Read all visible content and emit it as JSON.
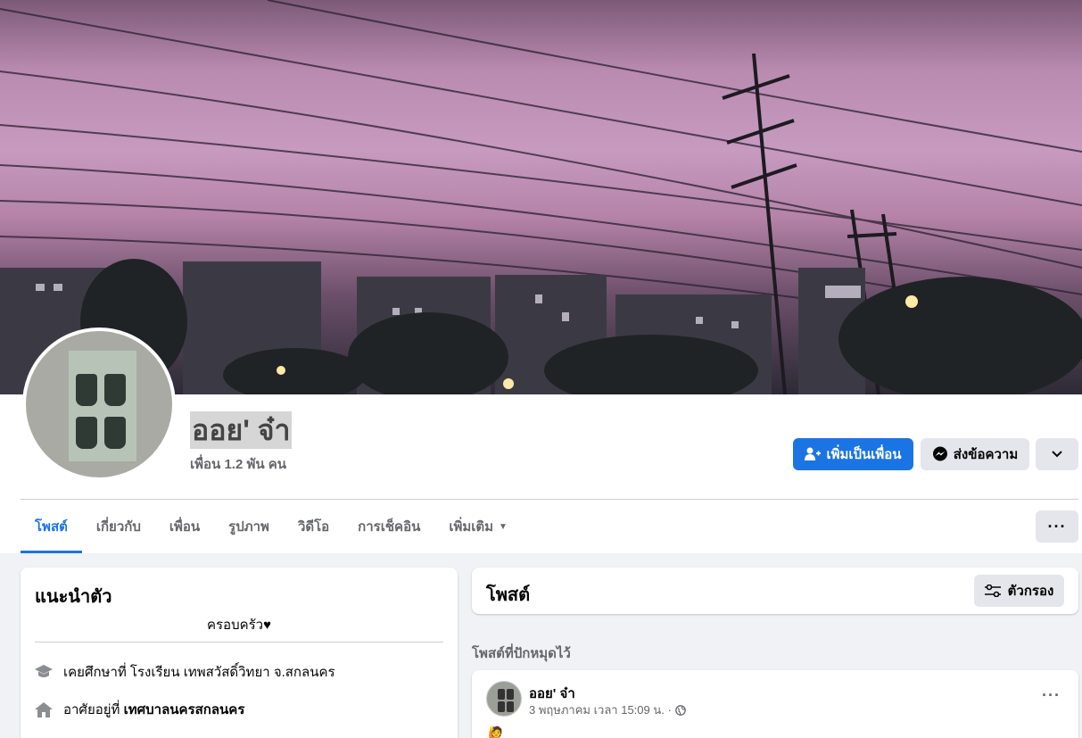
{
  "profile": {
    "name": "ออย' จ๋า",
    "friends": "เพื่อน 1.2 พัน คน"
  },
  "actions": {
    "add_friend": "เพิ่มเป็นเพื่อน",
    "message": "ส่งข้อความ"
  },
  "tabs": [
    {
      "label": "โพสต์",
      "active": true
    },
    {
      "label": "เกี่ยวกับ"
    },
    {
      "label": "เพื่อน"
    },
    {
      "label": "รูปภาพ"
    },
    {
      "label": "วิดีโอ"
    },
    {
      "label": "การเช็คอิน"
    },
    {
      "label": "เพิ่มเติม"
    }
  ],
  "intro": {
    "title": "แนะนำตัว",
    "bio": "ครอบครัว♥",
    "education_prefix": "เคยศึกษาที่ ",
    "education_value": "โรงเรียน เทพสวัสดิ์วิทยา จ.สกลนคร",
    "lives_prefix": "อาศัยอยู่ที่ ",
    "lives_value": "เทศบาลนครสกลนคร"
  },
  "posts": {
    "title": "โพสต์",
    "filter_label": "ตัวกรอง",
    "pinned_label": "โพสต์ที่ปักหมุดไว้"
  },
  "post": {
    "author": "ออย' จ๋า",
    "timestamp": "3 พฤษภาคม เวลา 15:09 น. ·",
    "emoji": "🙋"
  },
  "colors": {
    "accent": "#1b74e4",
    "secondary_button": "#e4e6eb",
    "page_background": "#f0f2f5"
  },
  "icons": {
    "add_friend": "person-plus-icon",
    "message": "messenger-icon",
    "chevron": "chevron-down-icon",
    "more": "ellipsis-icon",
    "filter": "sliders-icon",
    "education": "graduation-cap-icon",
    "home": "home-icon",
    "privacy": "globe-icon"
  }
}
